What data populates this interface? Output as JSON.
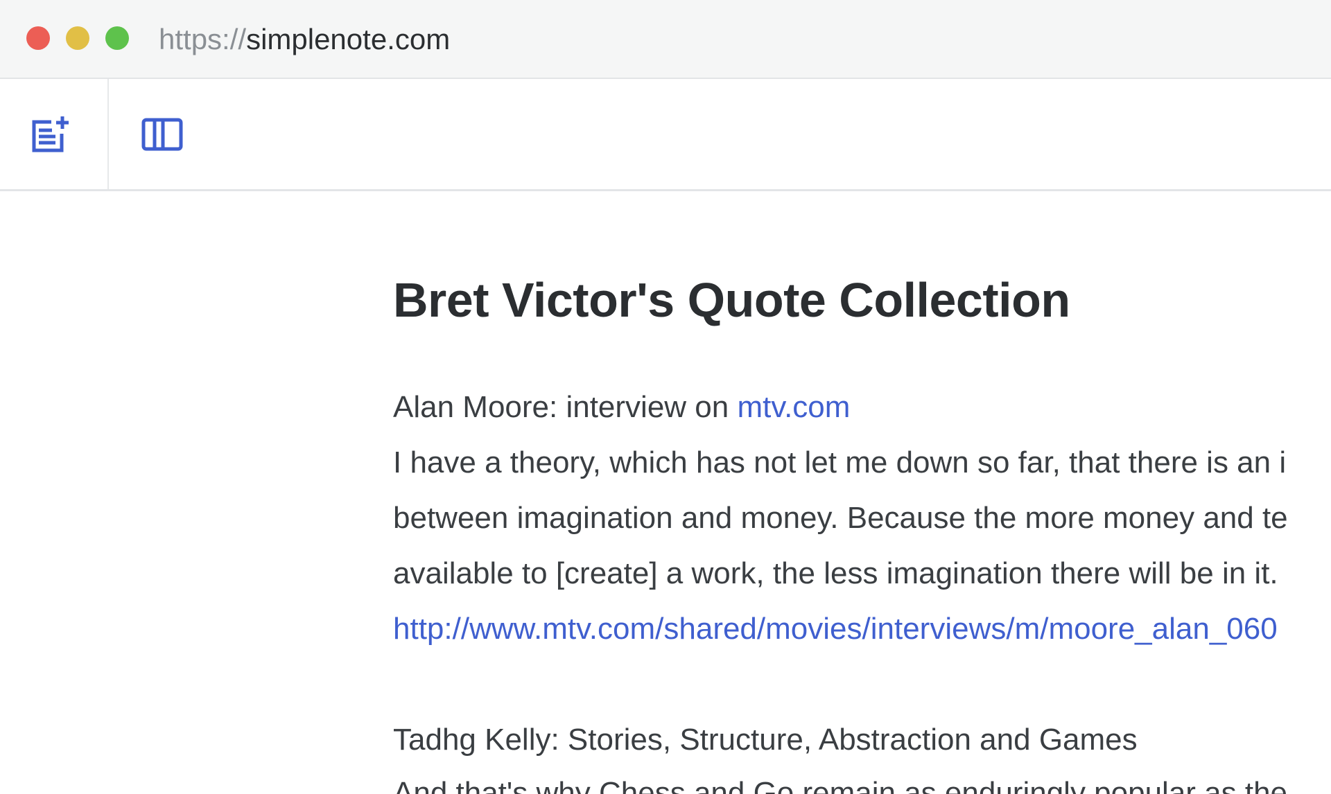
{
  "browser": {
    "url_scheme": "https://",
    "url_host": "simplenote.com",
    "traffic_lights": {
      "close": "#ec5e55",
      "minimize": "#e1bf46",
      "zoom": "#5ec24c"
    }
  },
  "toolbar": {
    "new_note_icon": "new-note-icon",
    "toggle_sidebar_icon": "columns-icon",
    "accent": "#3f5fcf"
  },
  "note": {
    "title": "Bret Victor's Quote Collection",
    "entry1": {
      "source_prefix": "Alan Moore: interview on ",
      "source_link": "mtv.com",
      "lines": [
        "I have a theory, which has not let me down so far, that there is an i",
        "between imagination and money. Because the more money and te",
        "available to [create] a work, the less imagination there will be in it."
      ],
      "url": "http://www.mtv.com/shared/movies/interviews/m/moore_alan_060"
    },
    "entry2": {
      "source": "Tadhg Kelly: Stories, Structure, Abstraction and Games",
      "partial_line": "And that's why Chess and Go remain as enduringly popular as the"
    }
  }
}
